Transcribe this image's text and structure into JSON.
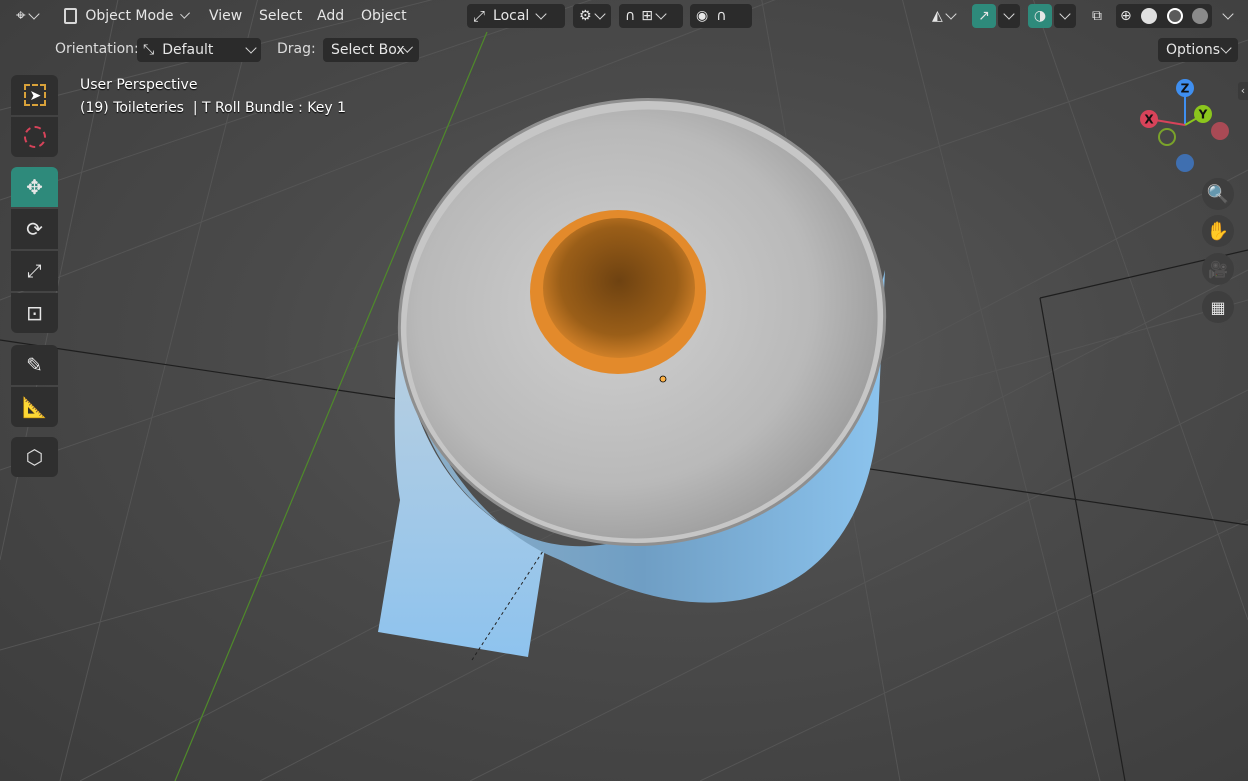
{
  "header": {
    "editor_type_icon": "editor-type-icon",
    "mode": "Object Mode",
    "menus": [
      "View",
      "Select",
      "Add",
      "Object"
    ],
    "transform_space": "Local"
  },
  "toolbar2": {
    "orientation_label": "Orientation:",
    "orientation_value": "Default",
    "drag_label": "Drag:",
    "drag_value": "Select Box",
    "options_label": "Options"
  },
  "viewport_info": {
    "view_name": "User Perspective",
    "object_info": "(19) Toileteries  | T Roll Bundle : Key 1"
  },
  "gizmo": {
    "x": "X",
    "y": "Y",
    "z": "Z"
  },
  "tools": [
    "select-box-icon",
    "cursor-icon",
    "move-icon",
    "rotate-icon",
    "scale-icon",
    "transform-icon",
    "annotate-icon",
    "measure-icon",
    "add-cube-icon"
  ],
  "colors": {
    "accent": "#2e8a7b",
    "x_axis": "#d8435a",
    "y_axis": "#8bc61d",
    "z_axis": "#3f8ff0",
    "roll_core": "#d9852a"
  }
}
